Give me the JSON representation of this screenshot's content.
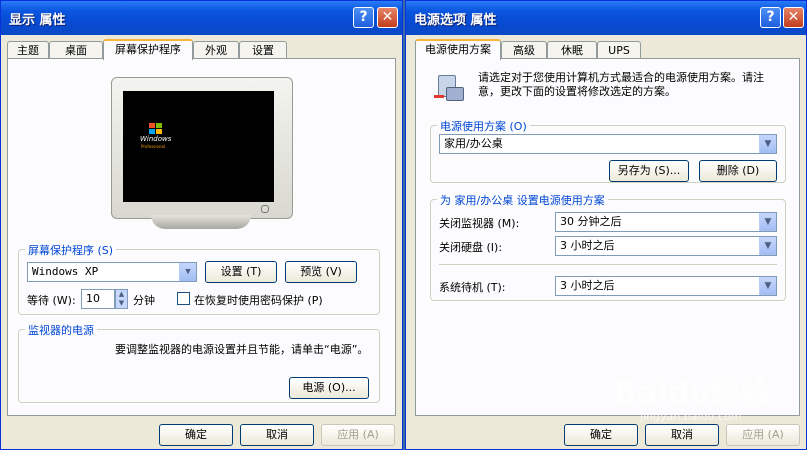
{
  "left_window": {
    "title": "显示 属性",
    "help_button": "?",
    "close_button": "✕",
    "tabs": [
      "主题",
      "桌面",
      "屏幕保护程序",
      "外观",
      "设置"
    ],
    "active_tab": "屏幕保护程序",
    "preview_screen": {
      "logo_text": "Windows",
      "logo_sub": "Professional"
    },
    "screensaver_group": {
      "title": "屏幕保护程序 (S)",
      "selected": "Windows XP",
      "settings_button": "设置 (T)",
      "preview_button": "预览 (V)",
      "wait_label": "等待 (W):",
      "wait_value": "10",
      "wait_unit": "分钟",
      "password_checkbox_label": "在恢复时使用密码保护 (P)",
      "password_checked": false
    },
    "monitor_power_group": {
      "title": "监视器的电源",
      "description": "要调整监视器的电源设置并且节能，请单击“电源”。",
      "power_button": "电源 (O)..."
    },
    "footer": {
      "ok": "确定",
      "cancel": "取消",
      "apply": "应用 (A)"
    }
  },
  "right_window": {
    "title": "电源选项 属性",
    "help_button": "?",
    "close_button": "✕",
    "tabs": [
      "电源使用方案",
      "高级",
      "休眠",
      "UPS"
    ],
    "active_tab": "电源使用方案",
    "intro_text": "请选定对于您使用计算机方式最适合的电源使用方案。请注意，更改下面的设置将修改选定的方案。",
    "scheme_group": {
      "title": "电源使用方案 (O)",
      "selected": "家用/办公桌",
      "save_as_button": "另存为 (S)...",
      "delete_button": "删除 (D)"
    },
    "settings_group": {
      "title": "为 家用/办公桌 设置电源使用方案",
      "rows": [
        {
          "label": "关闭监视器 (M):",
          "value": "30 分钟之后"
        },
        {
          "label": "关闭硬盘 (I):",
          "value": "3 小时之后"
        },
        {
          "label": "系统待机 (T):",
          "value": "3 小时之后"
        }
      ]
    },
    "footer": {
      "ok": "确定",
      "cancel": "取消",
      "apply": "应用 (A)"
    }
  },
  "watermark": {
    "text": "Baidu经验",
    "url": "jingyan.baidu.com"
  },
  "colors": {
    "titlebar": "#0a55e0",
    "dialog_bg": "#ece9d8",
    "group_title": "#0046d5",
    "tab_highlight": "#f7b53b"
  }
}
